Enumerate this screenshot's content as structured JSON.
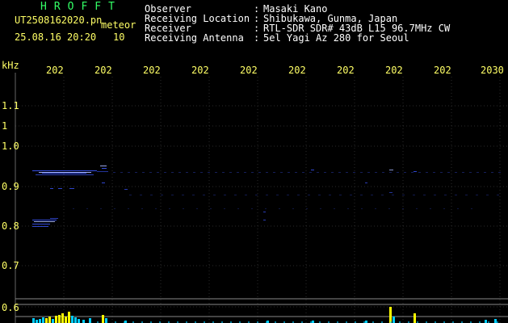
{
  "app": {
    "brand": "HROFFT",
    "file_name": "UT2508162020.pn",
    "mode_label": "meteor",
    "datetime": "25.08.16 20:20",
    "count": "10"
  },
  "info": {
    "rows": [
      {
        "label": "Observer",
        "value": "Masaki Kano"
      },
      {
        "label": "Receiving Location",
        "value": "Shibukawa, Gunma, Japan"
      },
      {
        "label": "Receiver",
        "value": "RTL-SDR SDR# 43dB L15 96.7MHz CW"
      },
      {
        "label": "Receiving Antenna",
        "value": "5el Yagi Az 280 for Seoul"
      }
    ],
    "separator": ":"
  },
  "axes": {
    "y_unit": "kHz",
    "x_tick_labels": [
      "202",
      "202",
      "202",
      "202",
      "202",
      "202",
      "202",
      "202",
      "202",
      "2030"
    ],
    "y_tick_labels": [
      "1.1",
      "1",
      "1.0",
      "0.9",
      "0.8",
      "0.7",
      "0.6"
    ]
  },
  "colors": {
    "background": "#000000",
    "text_header": "#ffff66",
    "brand": "#33ff66",
    "info_text": "#ffffff",
    "grid": "#2a2a2a",
    "axis_line": "#666666",
    "signal_blue": "#3b56ff",
    "signal_bright": "#aab8ff",
    "activity_cyan": "#00ccff",
    "activity_yellow": "#ffff00",
    "ruler_line": "#888888"
  }
}
